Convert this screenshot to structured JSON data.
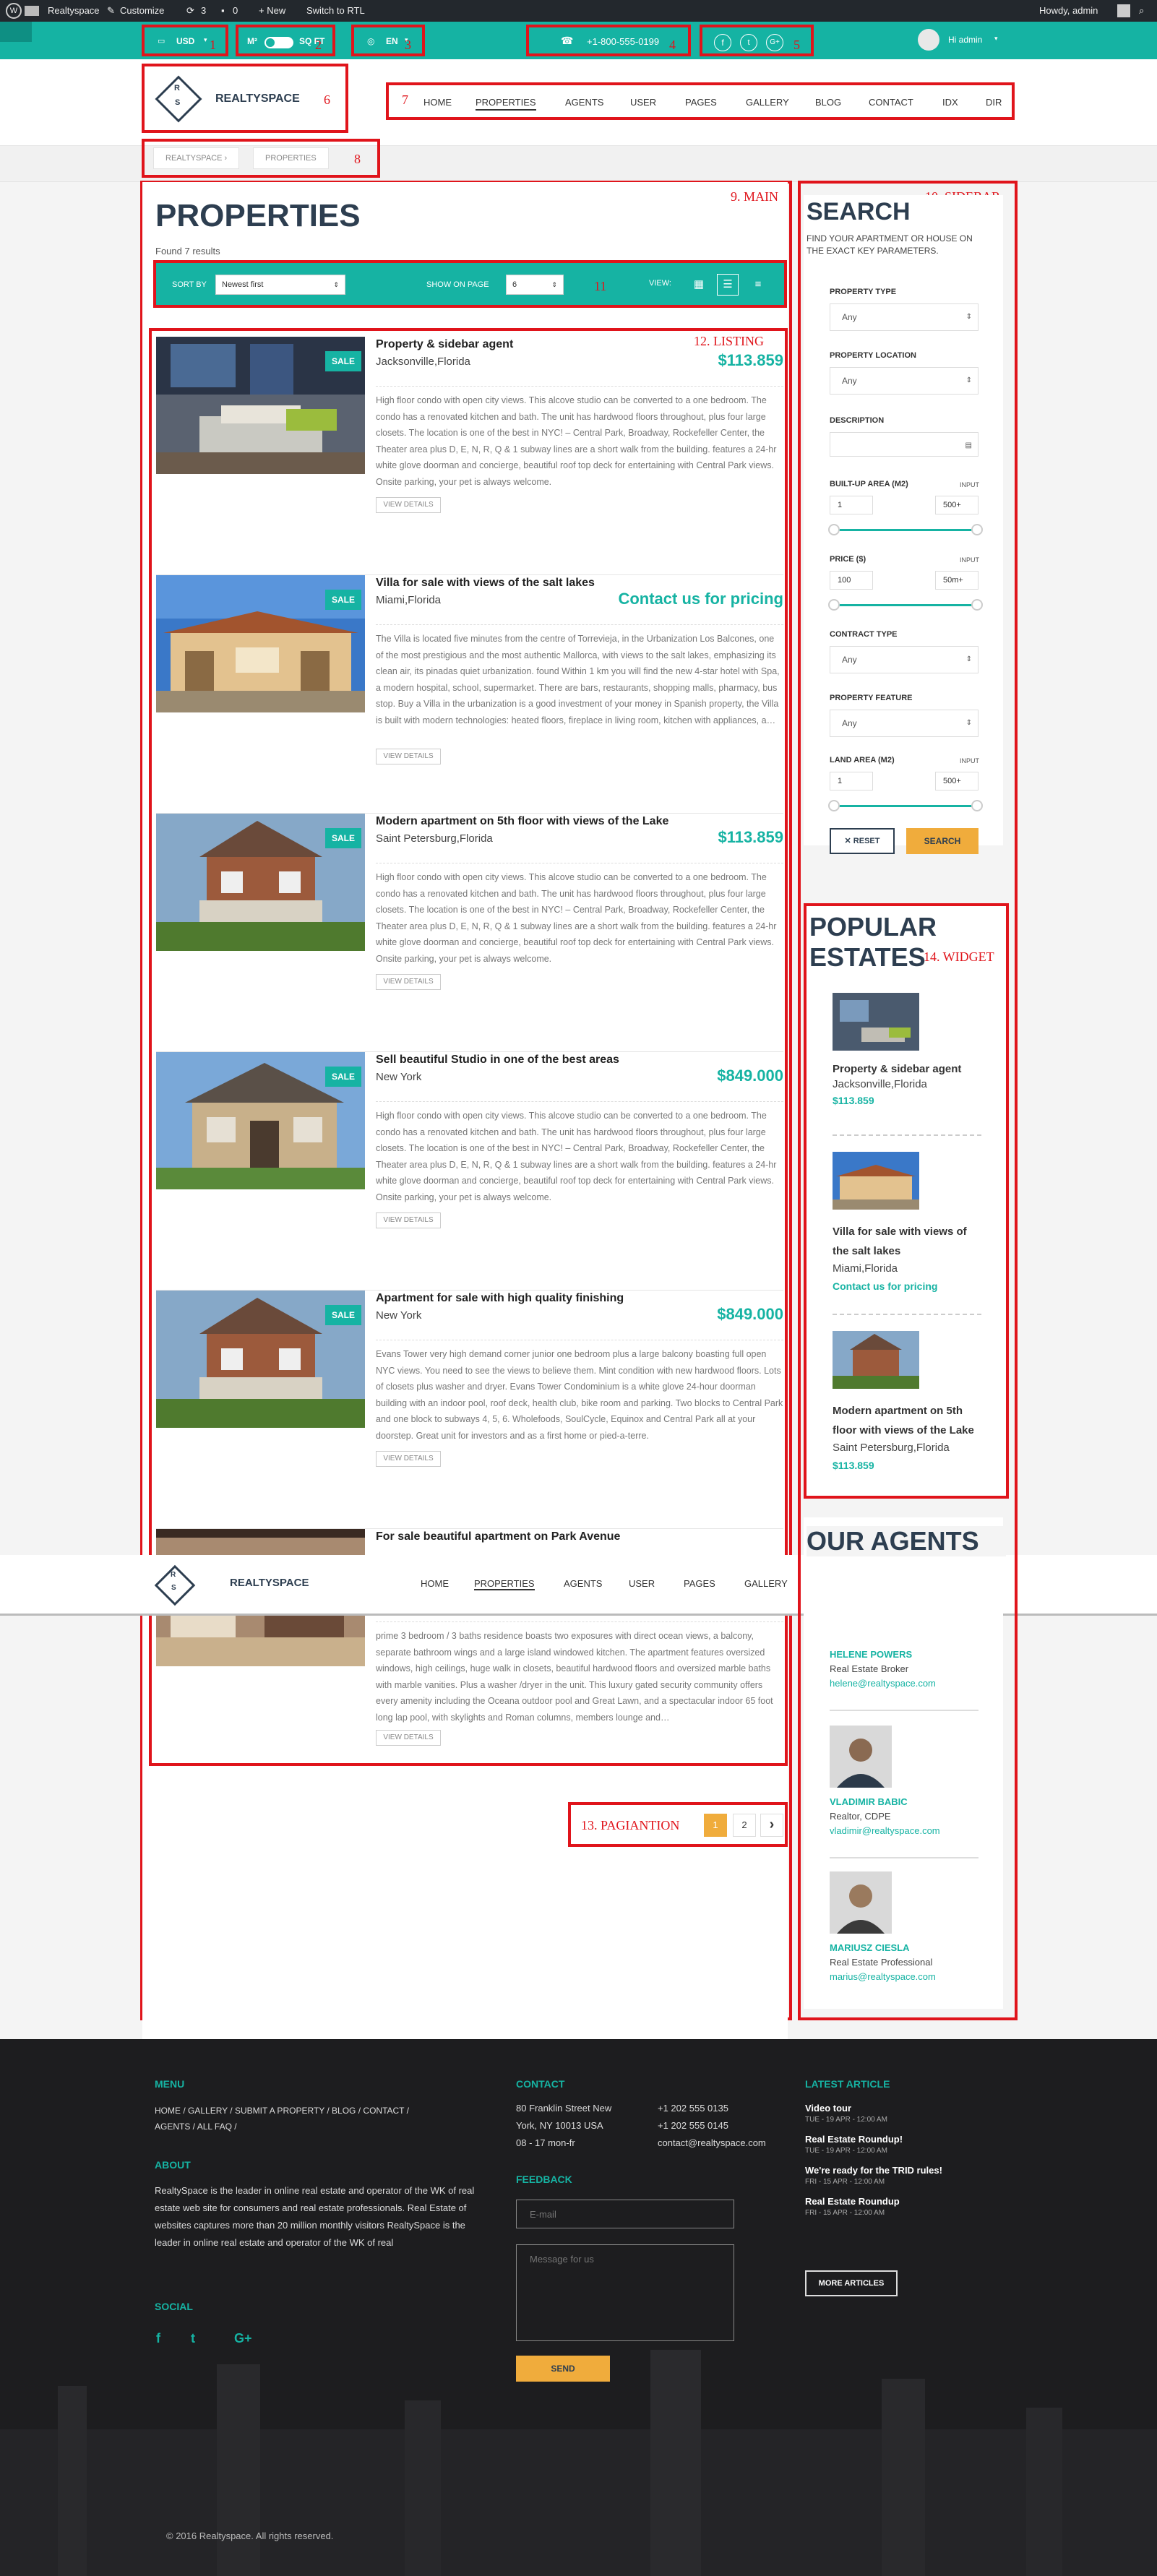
{
  "wp_admin_bar": {
    "site_name": "Realtyspace",
    "customize": "Customize",
    "updates": "3",
    "comments": "0",
    "new": "+ New",
    "rtl": "Switch to RTL",
    "howdy": "Howdy, admin"
  },
  "topbar": {
    "currency": "USD",
    "unit_left": "M²",
    "unit_right": "SQ FT",
    "language": "EN",
    "phone": "+1-800-555-0199",
    "user": "Hi admin"
  },
  "header": {
    "logo_text": "REALTYSPACE",
    "logo_letters": [
      "R",
      "S"
    ]
  },
  "nav": [
    "HOME",
    "PROPERTIES",
    "AGENTS",
    "USER",
    "PAGES",
    "GALLERY",
    "BLOG",
    "CONTACT",
    "IDX",
    "DIR"
  ],
  "breadcrumb": [
    "REALTYSPACE",
    "PROPERTIES"
  ],
  "annotations": {
    "a1": "1",
    "a2": "2",
    "a3": "3",
    "a4": "4",
    "a5": "5",
    "a6": "6",
    "a7": "7",
    "a8": "8",
    "main": "9. MAIN",
    "sidebar": "10. SIDEBAR",
    "toolbar": "11",
    "listing": "12. LISTING",
    "pagination": "13. PAGIANTION",
    "widget": "14. WIDGET"
  },
  "main": {
    "title": "PROPERTIES",
    "found": "Found 7 results",
    "sort_label": "SORT BY",
    "sort_value": "Newest first",
    "show_label": "SHOW ON PAGE",
    "show_value": "6",
    "view_label": "VIEW:"
  },
  "listings": [
    {
      "badge": "SALE",
      "title": "Property & sidebar agent",
      "location": "Jacksonville,Florida",
      "price": "$113.859",
      "description": "High floor condo with open city views. This alcove studio can be converted to a one bedroom. The condo has a renovated kitchen and bath. The unit has hardwood floors throughout, plus four large closets. The location is one of the best in NYC! – Central Park, Broadway, Rockefeller Center, the Theater area plus D, E, N, R, Q & 1 subway lines are a short walk from the building. features a 24-hr white glove doorman and concierge, beautiful roof top deck for entertaining with Central Park views. Onsite parking, your pet is always welcome.",
      "button": "VIEW DETAILS"
    },
    {
      "badge": "SALE",
      "title": "Villa for sale with views of the salt lakes",
      "location": "Miami,Florida",
      "price": "Contact us for pricing",
      "description": "The Villa is located five minutes from the centre of Torrevieja, in the Urbanization Los Balcones, one of the most prestigious and the most authentic Mallorca, with views to the salt lakes, emphasizing its clean air, its pinadas quiet urbanization. found Within 1 km you will find the new 4-star hotel with Spa, a modern hospital, school, supermarket. There are bars, restaurants, shopping malls, pharmacy, bus stop. Buy a Villa in the urbanization is a good investment of your money in Spanish property, the Villa is built with modern technologies: heated floors, fireplace in living room, kitchen with appliances, a…",
      "button": "VIEW DETAILS"
    },
    {
      "badge": "SALE",
      "title": "Modern apartment on 5th floor with views of the Lake",
      "location": "Saint Petersburg,Florida",
      "price": "$113.859",
      "description": "High floor condo with open city views. This alcove studio can be converted to a one bedroom. The condo has a renovated kitchen and bath. The unit has hardwood floors throughout, plus four large closets. The location is one of the best in NYC! – Central Park, Broadway, Rockefeller Center, the Theater area plus D, E, N, R, Q & 1 subway lines are a short walk from the building. features a 24-hr white glove doorman and concierge, beautiful roof top deck for entertaining with Central Park views. Onsite parking, your pet is always welcome.",
      "button": "VIEW DETAILS"
    },
    {
      "badge": "SALE",
      "title": "Sell beautiful Studio in one of the best areas",
      "location": "New York",
      "price": "$849.000",
      "description": "High floor condo with open city views. This alcove studio can be converted to a one bedroom. The condo has a renovated kitchen and bath. The unit has hardwood floors throughout, plus four large closets. The location is one of the best in NYC! – Central Park, Broadway, Rockefeller Center, the Theater area plus D, E, N, R, Q & 1 subway lines are a short walk from the building. features a 24-hr white glove doorman and concierge, beautiful roof top deck for entertaining with Central Park views. Onsite parking, your pet is always welcome.",
      "button": "VIEW DETAILS"
    },
    {
      "badge": "SALE",
      "title": "Apartment for sale with high quality finishing",
      "location": "New York",
      "price": "$849.000",
      "description": "Evans Tower very high demand corner junior one bedroom plus a large balcony boasting full open NYC views. You need to see the views to believe them. Mint condition with new hardwood floors. Lots of closets plus washer and dryer. Evans Tower Condominium is a white glove 24-hour doorman building with an indoor pool, roof deck, health club, bike room and parking. Two blocks to Central Park and one block to subways 4, 5, 6. Wholefoods, SoulCycle, Equinox and Central Park all at your doorstep. Great unit for investors and as a first home or pied-a-terre.",
      "button": "VIEW DETAILS"
    },
    {
      "badge": "",
      "title": "For sale beautiful apartment on Park Avenue",
      "location": "",
      "price": "",
      "description": "prime 3 bedroom / 3 baths residence boasts two exposures with direct ocean views, a balcony, separate bathroom wings and a large island windowed kitchen. The apartment features oversized windows, high ceilings, huge walk in closets, beautiful hardwood floors and oversized marble baths with marble vanities. Plus a washer /dryer in the unit. This luxury gated security community offers every amenity including the Oceana outdoor pool and Great Lawn, and a spectacular indoor 65 foot long lap pool, with skylights and Roman columns, members lounge and…",
      "button": "VIEW DETAILS"
    }
  ],
  "pagination": [
    "1",
    "2",
    "›"
  ],
  "search": {
    "title": "SEARCH",
    "subtitle": "FIND YOUR APARTMENT OR HOUSE ON THE EXACT KEY PARAMETERS.",
    "property_type_label": "PROPERTY TYPE",
    "property_type_value": "Any",
    "property_location_label": "PROPERTY LOCATION",
    "property_location_value": "Any",
    "description_label": "DESCRIPTION",
    "builtup_label": "BUILT-UP AREA (M2)",
    "builtup_input": "INPUT",
    "builtup_min": "1",
    "builtup_max": "500+",
    "price_label": "PRICE ($)",
    "price_input": "INPUT",
    "price_min": "100",
    "price_max": "50m+",
    "contract_label": "CONTRACT TYPE",
    "contract_value": "Any",
    "feature_label": "PROPERTY FEATURE",
    "feature_value": "Any",
    "land_label": "LAND AREA (M2)",
    "land_input": "INPUT",
    "land_min": "1",
    "land_max": "500+",
    "reset": "✕ RESET",
    "search": "SEARCH"
  },
  "popular": {
    "title": "POPULAR ESTATES",
    "items": [
      {
        "title": "Property & sidebar agent",
        "location": "Jacksonville,Florida",
        "price": "$113.859"
      },
      {
        "title": "Villa for sale with views of the salt lakes",
        "location": "Miami,Florida",
        "price": "Contact us for pricing"
      },
      {
        "title": "Modern apartment on 5th floor with views of the Lake",
        "location": "Saint Petersburg,Florida",
        "price": "$113.859"
      }
    ]
  },
  "agents": {
    "title": "OUR AGENTS",
    "items": [
      {
        "name": "HELENE POWERS",
        "role": "Real Estate Broker",
        "email": "helene@realtyspace.com"
      },
      {
        "name": "VLADIMIR BABIC",
        "role": "Realtor, CDPE",
        "email": "vladimir@realtyspace.com"
      },
      {
        "name": "MARIUSZ CIESLA",
        "role": "Real Estate Professional",
        "email": "marius@realtyspace.com"
      }
    ]
  },
  "footer": {
    "menu_title": "MENU",
    "menu_items": [
      "HOME",
      "GALLERY",
      "SUBMIT A PROPERTY",
      "BLOG",
      "CONTACT",
      "AGENTS",
      "ALL FAQ"
    ],
    "about_title": "ABOUT",
    "about_text": "RealtySpace is the leader in online real estate and operator of the WK of real estate web site for consumers and real estate professionals. Real Estate of websites captures more than 20 million monthly visitors RealtySpace is the leader in online real estate and operator of the WK of real",
    "social_title": "SOCIAL",
    "contact_title": "CONTACT",
    "address_1": "80 Franklin Street New",
    "address_2": "York, NY 10013 USA",
    "hours": "08 - 17 mon-fr",
    "phone_1": "+1 202 555 0135",
    "phone_2": "+1 202 555 0145",
    "email": "contact@realtyspace.com",
    "feedback_title": "FEEDBACK",
    "email_placeholder": "E-mail",
    "message_placeholder": "Message for us",
    "send": "SEND",
    "latest_title": "LATEST ARTICLE",
    "articles": [
      {
        "title": "Video tour",
        "date": "TUE - 19 APR - 12:00 AM"
      },
      {
        "title": "Real Estate Roundup!",
        "date": "TUE - 19 APR - 12:00 AM"
      },
      {
        "title": "We're ready for the TRID rules!",
        "date": "FRI - 15 APR - 12:00 AM"
      },
      {
        "title": "Real Estate Roundup",
        "date": "FRI - 15 APR - 12:00 AM"
      }
    ],
    "more_articles": "MORE ARTICLES",
    "copyright": "© 2016 Realtyspace. All rights reserved."
  },
  "colors": {
    "accent": "#16b3a3",
    "annotation": "#e0141b",
    "button_yellow": "#f0ac3c",
    "dark": "#23282d"
  }
}
